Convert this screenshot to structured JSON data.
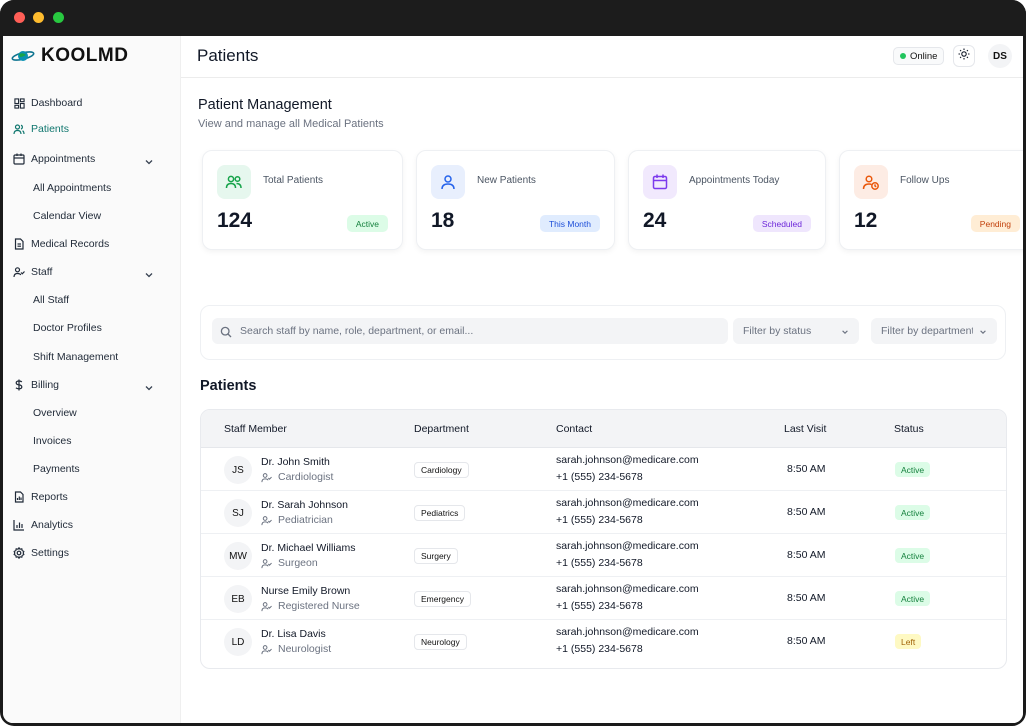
{
  "app": {
    "logo_text": "KOOLMD"
  },
  "sidebar": {
    "items": [
      {
        "label": "Dashboard",
        "icon": "dashboard-icon"
      },
      {
        "label": "Patients",
        "icon": "users-icon",
        "active": true
      },
      {
        "label": "Appointments",
        "icon": "calendar-icon",
        "expandable": true
      },
      {
        "label": "All Appointments",
        "sub": true
      },
      {
        "label": "Calendar View",
        "sub": true
      },
      {
        "label": "Medical Records",
        "icon": "file-icon"
      },
      {
        "label": "Staff",
        "icon": "user-check-icon",
        "expandable": true
      },
      {
        "label": "All Staff",
        "sub": true
      },
      {
        "label": "Doctor Profiles",
        "sub": true
      },
      {
        "label": "Shift Management",
        "sub": true
      },
      {
        "label": "Billing",
        "icon": "dollar-icon",
        "expandable": true
      },
      {
        "label": "Overview",
        "sub": true
      },
      {
        "label": "Invoices",
        "sub": true
      },
      {
        "label": "Payments",
        "sub": true
      },
      {
        "label": "Reports",
        "icon": "report-icon"
      },
      {
        "label": "Analytics",
        "icon": "bar-chart-icon"
      },
      {
        "label": "Settings",
        "icon": "gear-icon"
      }
    ]
  },
  "header": {
    "title": "Patients",
    "status": "Online",
    "avatar": "DS"
  },
  "main": {
    "title": "Patient Management",
    "subtitle": "View and manage all Medical Patients",
    "cards": [
      {
        "label": "Total Patients",
        "value": "124",
        "badge": "Active",
        "icon": "users-icon",
        "icon_bg": "#e6f7ee",
        "icon_color": "#16a34a",
        "badge_bg": "#dcfce7",
        "badge_color": "#15803d"
      },
      {
        "label": "New Patients",
        "value": "18",
        "badge": "This Month",
        "icon": "user-icon",
        "icon_bg": "#e8effd",
        "icon_color": "#2563eb",
        "badge_bg": "#e0ecfe",
        "badge_color": "#1d4ed8"
      },
      {
        "label": "Appointments Today",
        "value": "24",
        "badge": "Scheduled",
        "icon": "calendar-icon",
        "icon_bg": "#f1e9fd",
        "icon_color": "#7c3aed",
        "badge_bg": "#efe6fd",
        "badge_color": "#6d28d9"
      },
      {
        "label": "Follow Ups",
        "value": "12",
        "badge": "Pending",
        "icon": "user-clock-icon",
        "icon_bg": "#fdece4",
        "icon_color": "#ea580c",
        "badge_bg": "#ffedd5",
        "badge_color": "#c2410c"
      }
    ],
    "search_placeholder": "Search staff by name, role, department, or email...",
    "filter_status": "Filter by status",
    "filter_department": "Filter by department",
    "table_title": "Patients",
    "columns": [
      "Staff Member",
      "Department",
      "Contact",
      "Last Visit",
      "Status"
    ],
    "rows": [
      {
        "initials": "JS",
        "name": "Dr. John Smith",
        "role": "Cardiologist",
        "department": "Cardiology",
        "email": "sarah.johnson@medicare.com",
        "phone": "+1 (555) 234-5678",
        "last_visit": "8:50 AM",
        "status": "Active",
        "status_bg": "#dcfce7",
        "status_color": "#15803d"
      },
      {
        "initials": "SJ",
        "name": "Dr. Sarah Johnson",
        "role": "Pediatrician",
        "department": "Pediatrics",
        "email": "sarah.johnson@medicare.com",
        "phone": "+1 (555) 234-5678",
        "last_visit": "8:50 AM",
        "status": "Active",
        "status_bg": "#dcfce7",
        "status_color": "#15803d"
      },
      {
        "initials": "MW",
        "name": "Dr. Michael Williams",
        "role": "Surgeon",
        "department": "Surgery",
        "email": "sarah.johnson@medicare.com",
        "phone": "+1 (555) 234-5678",
        "last_visit": "8:50 AM",
        "status": "Active",
        "status_bg": "#dcfce7",
        "status_color": "#15803d"
      },
      {
        "initials": "EB",
        "name": "Nurse Emily Brown",
        "role": "Registered Nurse",
        "department": "Emergency",
        "email": "sarah.johnson@medicare.com",
        "phone": "+1 (555) 234-5678",
        "last_visit": "8:50 AM",
        "status": "Active",
        "status_bg": "#dcfce7",
        "status_color": "#15803d"
      },
      {
        "initials": "LD",
        "name": "Dr. Lisa Davis",
        "role": "Neurologist",
        "department": "Neurology",
        "email": "sarah.johnson@medicare.com",
        "phone": "+1 (555) 234-5678",
        "last_visit": "8:50 AM",
        "status": "Left",
        "status_bg": "#fef9c3",
        "status_color": "#a16207"
      }
    ]
  }
}
